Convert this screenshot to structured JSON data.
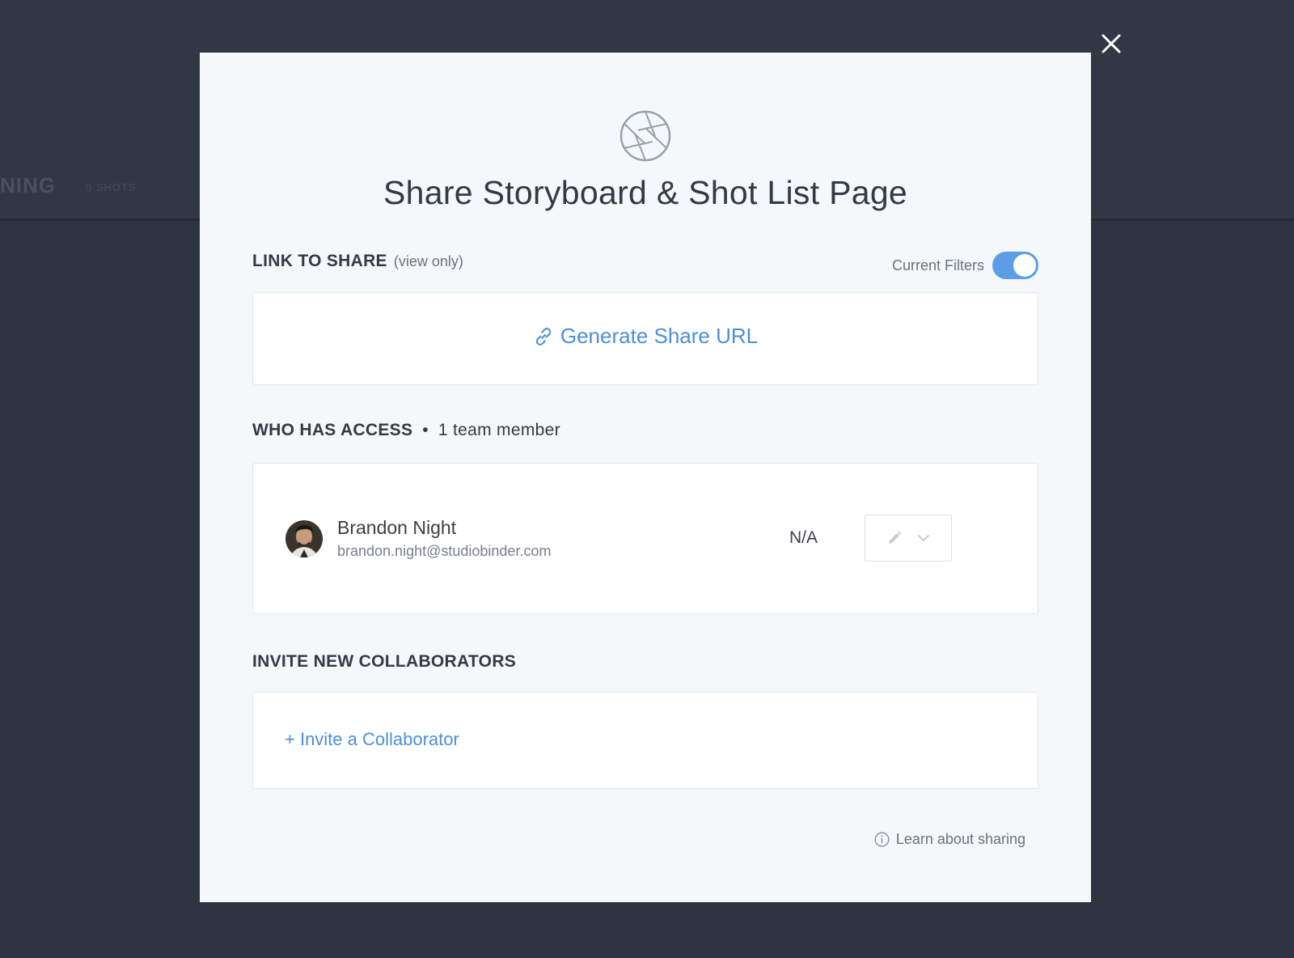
{
  "background": {
    "page_title": "NING",
    "shot_count": "0 SHOTS"
  },
  "modal": {
    "title": "Share Storyboard & Shot List Page",
    "logo_icon": "aperture-icon",
    "close_icon": "close-icon",
    "link_section": {
      "label": "LINK TO SHARE",
      "sublabel": "(view only)",
      "filters_label": "Current Filters",
      "filters_enabled": true,
      "generate_label": "Generate Share URL",
      "generate_icon": "link-icon"
    },
    "access_section": {
      "label": "WHO HAS ACCESS",
      "separator": "•",
      "count": "1 team member",
      "members": [
        {
          "name": "Brandon Night",
          "email": "brandon.night@studiobinder.com",
          "role": "N/A",
          "permission_icon": "pencil-icon",
          "dropdown_icon": "chevron-down-icon"
        }
      ]
    },
    "invite_section": {
      "label": "INVITE NEW COLLABORATORS",
      "invite_link": "+ Invite a Collaborator"
    },
    "learn_link": "Learn about sharing",
    "learn_icon": "info-icon"
  },
  "colors": {
    "accent": "#5b9ee6",
    "link": "#4a90d9",
    "overlay": "#2e3340",
    "modal_bg": "#f5f8fb"
  }
}
